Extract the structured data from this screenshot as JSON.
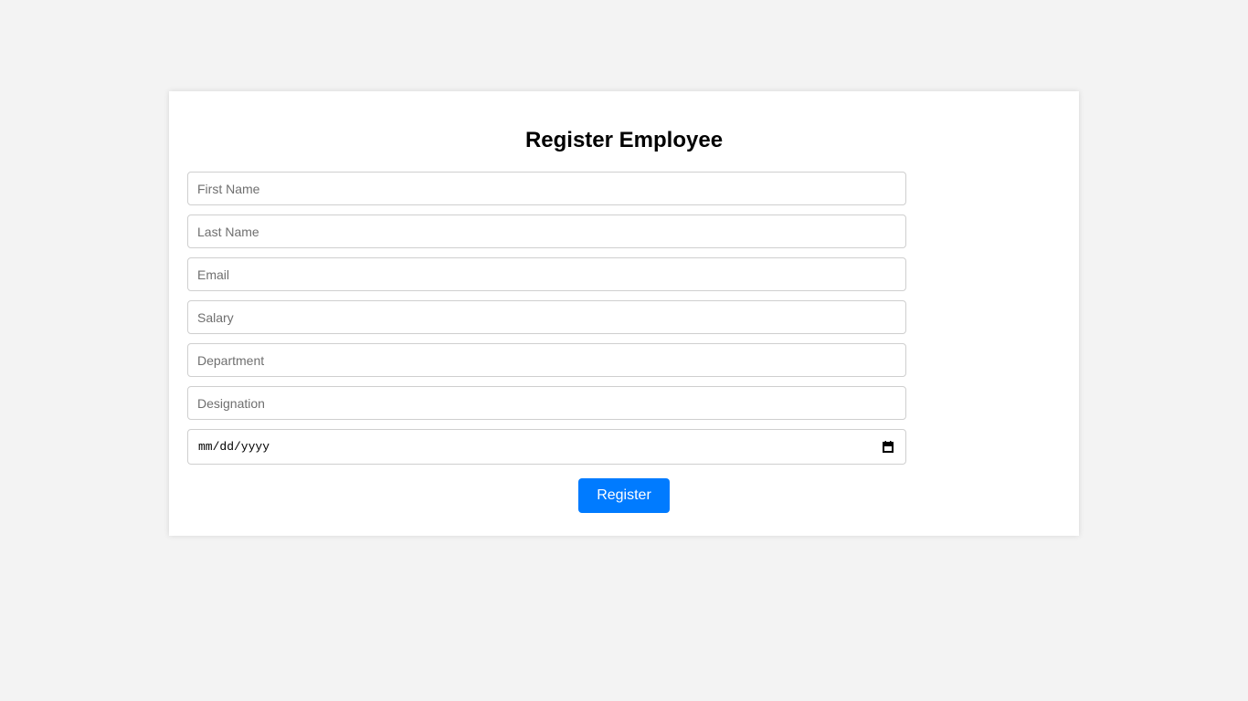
{
  "form": {
    "title": "Register Employee",
    "fields": [
      {
        "placeholder": "First Name",
        "value": ""
      },
      {
        "placeholder": "Last Name",
        "value": ""
      },
      {
        "placeholder": "Email",
        "value": ""
      },
      {
        "placeholder": "Salary",
        "value": ""
      },
      {
        "placeholder": "Department",
        "value": ""
      },
      {
        "placeholder": "Designation",
        "value": ""
      }
    ],
    "date_field": {
      "placeholder": "mm/dd/yyyy",
      "icon": "calendar-icon"
    },
    "submit_label": "Register"
  },
  "colors": {
    "page_background": "#f3f3f3",
    "card_background": "#ffffff",
    "button_background": "#007bff",
    "button_text": "#ffffff"
  }
}
